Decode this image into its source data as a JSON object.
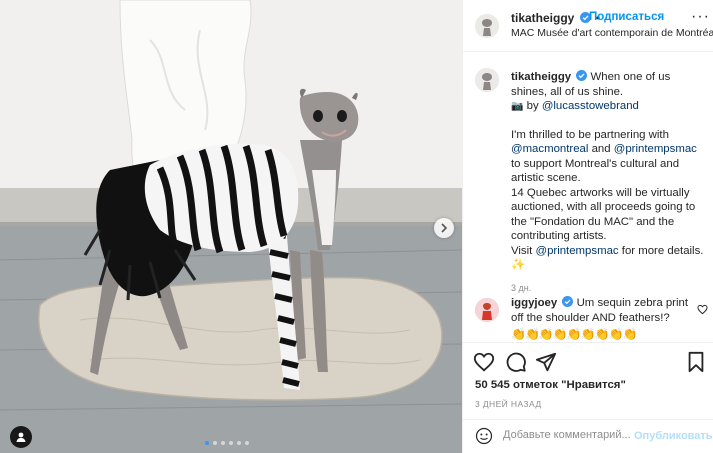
{
  "post": {
    "username": "tikatheiggy",
    "follow_label": "Подписаться",
    "separator": "•",
    "location": "MAC Musée d'art contemporain de Montréal",
    "more_glyph": "···"
  },
  "caption": {
    "username": "tikatheiggy",
    "text_line1": "When one of us shines, all of us shine.",
    "by_prefix": "by",
    "by_mention": "@lucasstowebrand",
    "para2_a": "I'm thrilled to be partnering with",
    "para2_mention1": "@macmontreal",
    "para2_and": "and",
    "para2_mention2": "@printempsmac",
    "para2_b": "to support Montreal's cultural and artistic scene.",
    "para3": "14 Quebec artworks will be virtually auctioned, with all proceeds going to the \"Fondation du MAC\" and the contributing artists.",
    "para4_a": "Visit",
    "para4_mention": "@printempsmac",
    "para4_b": "for more details.",
    "sparkle": "✨",
    "time": "3 дн."
  },
  "comment": {
    "username": "iggyjoey",
    "text": "Um sequin zebra print off the shoulder AND feathers!?",
    "emojis": "👏👏👏👏👏👏👏👏👏"
  },
  "engagement": {
    "likes": "50 545 отметок \"Нравится\"",
    "date": "3 ДНЕЙ НАЗАД"
  },
  "add_comment": {
    "placeholder": "Добавьте комментарий...",
    "publish_label": "Опубликовать"
  },
  "colors": {
    "accent": "#0095f6",
    "verified": "#3897f0",
    "mention": "#00376b",
    "publish_disabled": "#b2dffc"
  },
  "icons": [
    "verified-badge-icon",
    "more-options-icon",
    "heart-icon",
    "comment-icon",
    "share-icon",
    "bookmark-icon",
    "emoji-icon",
    "next-arrow-icon",
    "user-tag-icon"
  ],
  "carousel": {
    "total": 6,
    "active_index": 0
  }
}
